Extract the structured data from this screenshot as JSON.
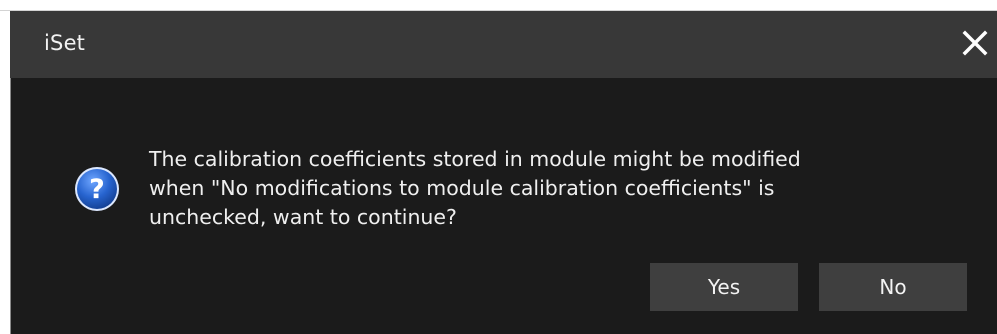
{
  "window": {
    "title": "iSet",
    "close_icon": "close-icon"
  },
  "message": {
    "icon": "question-icon",
    "lines": [
      "The calibration coefficients stored in module might be modified",
      "when \"No modifications to module calibration coefficients\" is",
      "unchecked, want to continue?"
    ]
  },
  "buttons": {
    "yes_label": "Yes",
    "no_label": "No"
  },
  "colors": {
    "titlebar_bg": "#383838",
    "body_bg": "#1b1b1b",
    "button_bg": "#3f3f3f",
    "icon_blue": "#1f5fc7",
    "text": "#efefef"
  }
}
